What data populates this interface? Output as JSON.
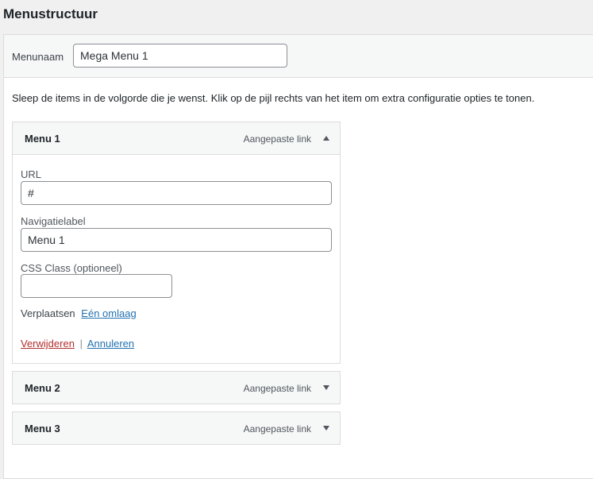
{
  "page_title": "Menustructuur",
  "menu_name": {
    "label": "Menunaam",
    "value": "Mega Menu 1"
  },
  "instructions": "Sleep de items in de volgorde die je wenst. Klik op de pijl rechts van het item om extra configuratie opties te tonen.",
  "items": [
    {
      "title": "Menu 1",
      "type": "Aangepaste link",
      "expanded": true,
      "toggle_icon": "triangle-up-icon",
      "settings": {
        "url_label": "URL",
        "url_value": "#",
        "nav_label": "Navigatielabel",
        "nav_value": "Menu 1",
        "css_label": "CSS Class (optioneel)",
        "css_value": "",
        "move_label": "Verplaatsen",
        "move_link": "Eén omlaag",
        "delete_label": "Verwijderen",
        "separator": "|",
        "cancel_label": "Annuleren"
      }
    },
    {
      "title": "Menu 2",
      "type": "Aangepaste link",
      "expanded": false,
      "toggle_icon": "triangle-down-icon"
    },
    {
      "title": "Menu 3",
      "type": "Aangepaste link",
      "expanded": false,
      "toggle_icon": "triangle-down-icon"
    }
  ],
  "colors": {
    "link": "#2271b1",
    "delete": "#b32d2e",
    "border": "#dcdcde",
    "bar_bg": "#f6f7f7"
  }
}
